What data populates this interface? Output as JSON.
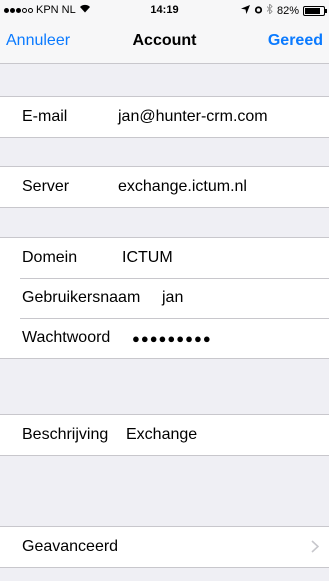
{
  "status_bar": {
    "carrier": "KPN NL",
    "time": "14:19",
    "battery_percent": "82%",
    "battery_level": 0.82
  },
  "nav": {
    "cancel_label": "Annuleer",
    "title": "Account",
    "done_label": "Gereed"
  },
  "fields": {
    "email": {
      "label": "E-mail",
      "value": "jan@hunter-crm.com"
    },
    "server": {
      "label": "Server",
      "value": "exchange.ictum.nl"
    },
    "domain": {
      "label": "Domein",
      "value": "ICTUM"
    },
    "username": {
      "label": "Gebruikersnaam",
      "value": "jan"
    },
    "password": {
      "label": "Wachtwoord",
      "value": "●●●●●●●●●"
    },
    "description": {
      "label": "Beschrijving",
      "value": "Exchange"
    },
    "advanced": {
      "label": "Geavanceerd"
    }
  },
  "icons": {
    "wifi": "wifi-icon",
    "location": "location-arrow-icon",
    "alarm": "alarm-icon",
    "bluetooth": "bluetooth-icon",
    "chevron": "chevron-right-icon"
  }
}
